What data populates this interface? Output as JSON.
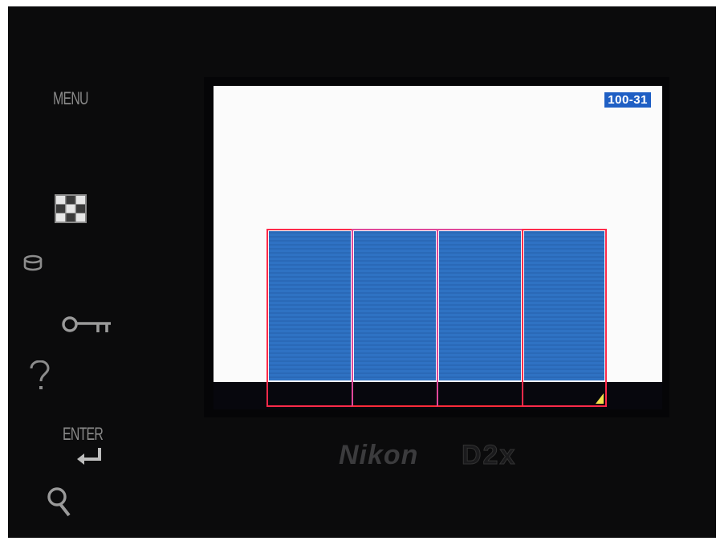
{
  "buttons": {
    "menu_label": "MENU",
    "enter_label": "ENTER"
  },
  "icons": {
    "thumbnail": "thumbnail-icon",
    "protect": "protect-icon",
    "key": "key-icon",
    "help": "help-icon",
    "enter": "enter-arrow-icon",
    "zoom": "zoom-icon"
  },
  "lcd": {
    "folder_frame": "100-31",
    "thumbnail_count": 4,
    "selected_index": 3
  },
  "branding": {
    "maker": "Nikon",
    "model": "D2x"
  },
  "colors": {
    "badge_bg": "#1f5fc4",
    "thumb_image": "#2f72c3",
    "thumb_frame": "#ff2a4a",
    "thumb_divider": "#e0489a",
    "selection_marker": "#f4e24a"
  }
}
